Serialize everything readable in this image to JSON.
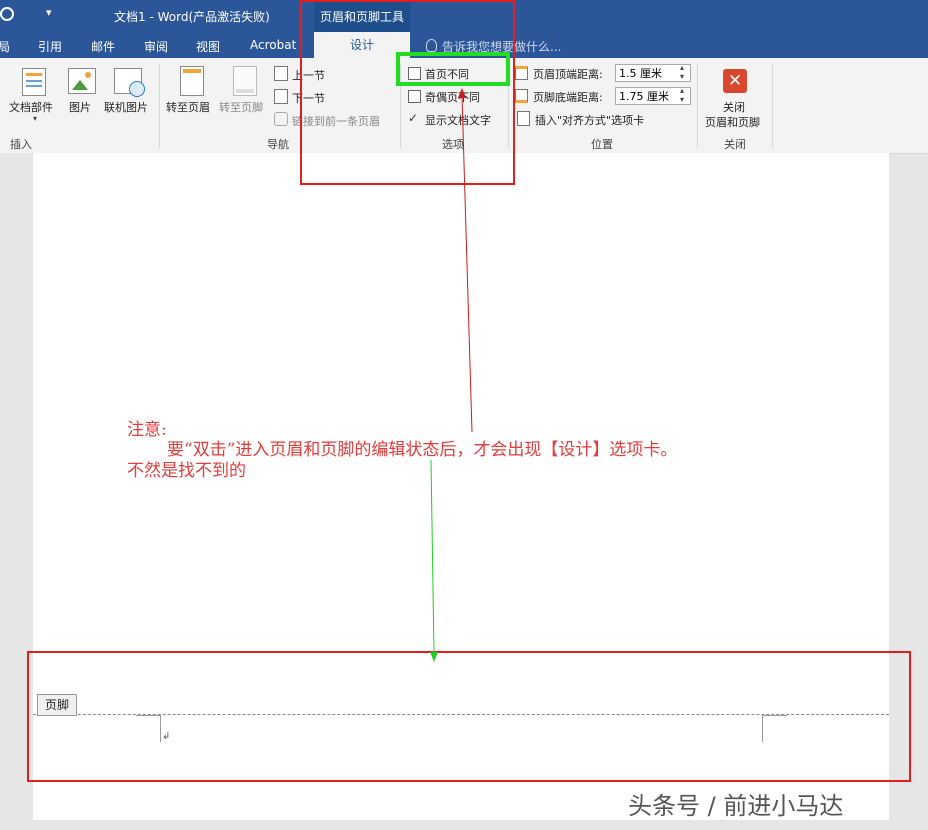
{
  "titlebar": {
    "left_fragment": "局",
    "title": "文档1 - Word(产品激活失败)",
    "context_header": "页眉和页脚工具"
  },
  "tabs": [
    "引用",
    "邮件",
    "审阅",
    "视图",
    "Acrobat"
  ],
  "active_tab": "设计",
  "search_hint": "告诉我您想要做什么...",
  "ribbon": {
    "insert": {
      "doc_parts": "文档部件",
      "picture": "图片",
      "online_picture": "联机图片",
      "group_label": "插入"
    },
    "navigation": {
      "goto_header": "转至页眉",
      "goto_footer": "转至页脚",
      "prev_section": "上一节",
      "next_section": "下一节",
      "link_previous": "链接到前一条页眉",
      "group_label": "导航"
    },
    "options": {
      "first_page_diff": "首页不同",
      "odd_even_diff": "奇偶页不同",
      "show_doc_text": "显示文档文字",
      "group_label": "选项"
    },
    "position": {
      "header_top_label": "页眉顶端距离:",
      "header_top_value": "1.5 厘米",
      "footer_bottom_label": "页脚底端距离:",
      "footer_bottom_value": "1.75 厘米",
      "insert_align_tab": "插入\"对齐方式\"选项卡",
      "group_label": "位置"
    },
    "close": {
      "line1": "关闭",
      "line2": "页眉和页脚",
      "group_label": "关闭"
    }
  },
  "annotation": {
    "line1": "注意:",
    "line2": "要“双击”进入页眉和页脚的编辑状态后，才会出现【设计】选项卡。",
    "line3": "不然是找不到的"
  },
  "footer_tag": "页脚",
  "watermark": "头条号 / 前进小马达",
  "colors": {
    "title_bar": "#2b579a",
    "annotation_red": "#e23c3c",
    "highlight_green": "#22dd22",
    "highlight_red": "#e02020"
  }
}
